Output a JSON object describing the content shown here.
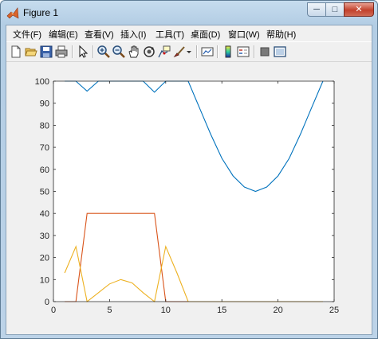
{
  "window": {
    "title": "Figure 1",
    "minimize_glyph": "─",
    "maximize_glyph": "□",
    "close_glyph": "✕"
  },
  "menu": [
    {
      "label": "文件(F)"
    },
    {
      "label": "编辑(E)"
    },
    {
      "label": "查看(V)"
    },
    {
      "label": "插入(I)"
    },
    {
      "label": "工具(T)"
    },
    {
      "label": "桌面(D)"
    },
    {
      "label": "窗口(W)"
    },
    {
      "label": "帮助(H)"
    }
  ],
  "toolbar": [
    {
      "icon": "new-figure-icon"
    },
    {
      "icon": "open-file-icon"
    },
    {
      "icon": "save-icon"
    },
    {
      "icon": "print-icon"
    },
    {
      "icon": "edit-plot-arrow-icon"
    },
    {
      "icon": "zoom-in-icon"
    },
    {
      "icon": "zoom-out-icon"
    },
    {
      "icon": "pan-hand-icon"
    },
    {
      "icon": "rotate-3d-icon"
    },
    {
      "icon": "data-cursor-icon"
    },
    {
      "icon": "brush-icon"
    },
    {
      "icon": "link-plot-icon"
    },
    {
      "icon": "colorbar-icon"
    },
    {
      "icon": "legend-icon"
    },
    {
      "icon": "hide-plot-tools-icon"
    },
    {
      "icon": "show-plot-tools-icon"
    }
  ],
  "chart_data": {
    "type": "line",
    "xlim": [
      0,
      25
    ],
    "ylim": [
      0,
      100
    ],
    "xticks": [
      0,
      5,
      10,
      15,
      20,
      25
    ],
    "yticks": [
      0,
      10,
      20,
      30,
      40,
      50,
      60,
      70,
      80,
      90,
      100
    ],
    "grid": false,
    "series": [
      {
        "color": "#0072bd",
        "x": [
          1,
          2,
          3,
          4,
          5,
          6,
          7,
          8,
          9,
          10,
          11,
          12,
          13,
          14,
          15,
          16,
          17,
          18,
          19,
          20,
          21,
          22,
          23,
          24
        ],
        "y": [
          100,
          100,
          95.5,
          100,
          100,
          100,
          100,
          100,
          95,
          100,
          100,
          100,
          88,
          76,
          65,
          57,
          52,
          50,
          52,
          57,
          65,
          76,
          88,
          100
        ]
      },
      {
        "color": "#d95319",
        "x": [
          1,
          2,
          3,
          4,
          5,
          6,
          7,
          8,
          9,
          10,
          11,
          12,
          13,
          14,
          15,
          16,
          17,
          18,
          19,
          20,
          21,
          22,
          23,
          24
        ],
        "y": [
          0,
          0,
          40,
          40,
          40,
          40,
          40,
          40,
          40,
          0,
          0,
          0,
          0,
          0,
          0,
          0,
          0,
          0,
          0,
          0,
          0,
          0,
          0,
          0
        ]
      },
      {
        "color": "#edb120",
        "x": [
          1,
          2,
          3,
          4,
          5,
          6,
          7,
          8,
          9,
          10,
          11,
          12,
          13,
          14,
          15,
          16,
          17,
          18,
          19,
          20,
          21,
          22,
          23,
          24
        ],
        "y": [
          13,
          25,
          0,
          4,
          8,
          10,
          8.5,
          4,
          0,
          25,
          13,
          0,
          0,
          0,
          0,
          0,
          0,
          0,
          0,
          0,
          0,
          0,
          0,
          0
        ]
      }
    ]
  },
  "colors": {
    "axes_bg": "#ffffff",
    "axis_line": "#262626",
    "tick_text": "#262626"
  }
}
